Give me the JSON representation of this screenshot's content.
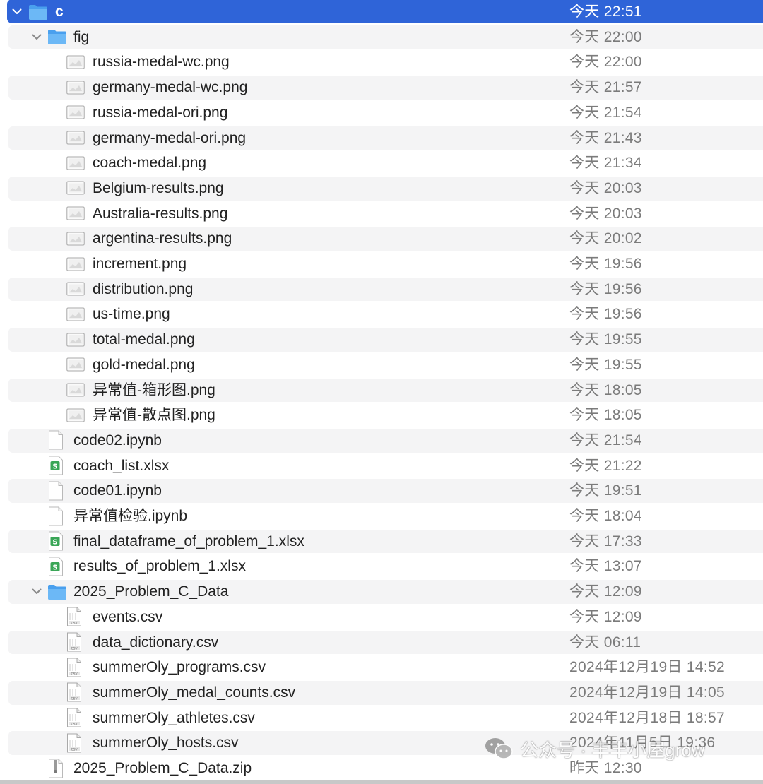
{
  "colors": {
    "selection": "#2f64d8",
    "stripe": "#f4f4f5",
    "folder": "#5aabf2",
    "spreadsheet": "#3aa657",
    "date_text": "#7b7b7b"
  },
  "rows": [
    {
      "name": "c",
      "date": "今天 22:51",
      "level": 0,
      "kind": "folder",
      "expanded": true,
      "selected": true
    },
    {
      "name": "fig",
      "date": "今天 22:00",
      "level": 1,
      "kind": "folder",
      "expanded": true
    },
    {
      "name": "russia-medal-wc.png",
      "date": "今天 22:00",
      "level": 2,
      "kind": "image"
    },
    {
      "name": "germany-medal-wc.png",
      "date": "今天 21:57",
      "level": 2,
      "kind": "image"
    },
    {
      "name": "russia-medal-ori.png",
      "date": "今天 21:54",
      "level": 2,
      "kind": "image"
    },
    {
      "name": "germany-medal-ori.png",
      "date": "今天 21:43",
      "level": 2,
      "kind": "image"
    },
    {
      "name": "coach-medal.png",
      "date": "今天 21:34",
      "level": 2,
      "kind": "image"
    },
    {
      "name": "Belgium-results.png",
      "date": "今天 20:03",
      "level": 2,
      "kind": "image"
    },
    {
      "name": "Australia-results.png",
      "date": "今天 20:03",
      "level": 2,
      "kind": "image"
    },
    {
      "name": "argentina-results.png",
      "date": "今天 20:02",
      "level": 2,
      "kind": "image"
    },
    {
      "name": "increment.png",
      "date": "今天 19:56",
      "level": 2,
      "kind": "image"
    },
    {
      "name": "distribution.png",
      "date": "今天 19:56",
      "level": 2,
      "kind": "image"
    },
    {
      "name": "us-time.png",
      "date": "今天 19:56",
      "level": 2,
      "kind": "image"
    },
    {
      "name": "total-medal.png",
      "date": "今天 19:55",
      "level": 2,
      "kind": "image"
    },
    {
      "name": "gold-medal.png",
      "date": "今天 19:55",
      "level": 2,
      "kind": "image"
    },
    {
      "name": "异常值-箱形图.png",
      "date": "今天 18:05",
      "level": 2,
      "kind": "image"
    },
    {
      "name": "异常值-散点图.png",
      "date": "今天 18:05",
      "level": 2,
      "kind": "image"
    },
    {
      "name": "code02.ipynb",
      "date": "今天 21:54",
      "level": 1,
      "kind": "document"
    },
    {
      "name": "coach_list.xlsx",
      "date": "今天 21:22",
      "level": 1,
      "kind": "spreadsheet"
    },
    {
      "name": "code01.ipynb",
      "date": "今天 19:51",
      "level": 1,
      "kind": "document"
    },
    {
      "name": "异常值检验.ipynb",
      "date": "今天 18:04",
      "level": 1,
      "kind": "document"
    },
    {
      "name": "final_dataframe_of_problem_1.xlsx",
      "date": "今天 17:33",
      "level": 1,
      "kind": "spreadsheet"
    },
    {
      "name": "results_of_problem_1.xlsx",
      "date": "今天 13:07",
      "level": 1,
      "kind": "spreadsheet"
    },
    {
      "name": "2025_Problem_C_Data",
      "date": "今天 12:09",
      "level": 1,
      "kind": "folder",
      "expanded": true
    },
    {
      "name": "events.csv",
      "date": "今天 12:09",
      "level": 2,
      "kind": "csv"
    },
    {
      "name": "data_dictionary.csv",
      "date": "今天 06:11",
      "level": 2,
      "kind": "csv"
    },
    {
      "name": "summerOly_programs.csv",
      "date": "2024年12月19日 14:52",
      "level": 2,
      "kind": "csv"
    },
    {
      "name": "summerOly_medal_counts.csv",
      "date": "2024年12月19日 14:05",
      "level": 2,
      "kind": "csv"
    },
    {
      "name": "summerOly_athletes.csv",
      "date": "2024年12月18日 18:57",
      "level": 2,
      "kind": "csv"
    },
    {
      "name": "summerOly_hosts.csv",
      "date": "2024年11月5日 19:36",
      "level": 2,
      "kind": "csv"
    },
    {
      "name": "2025_Problem_C_Data.zip",
      "date": "昨天 12:30",
      "level": 1,
      "kind": "archive"
    }
  ],
  "watermark": {
    "text": "公众号 · 丰丰小屋grow",
    "icon": "wechat-icon"
  }
}
